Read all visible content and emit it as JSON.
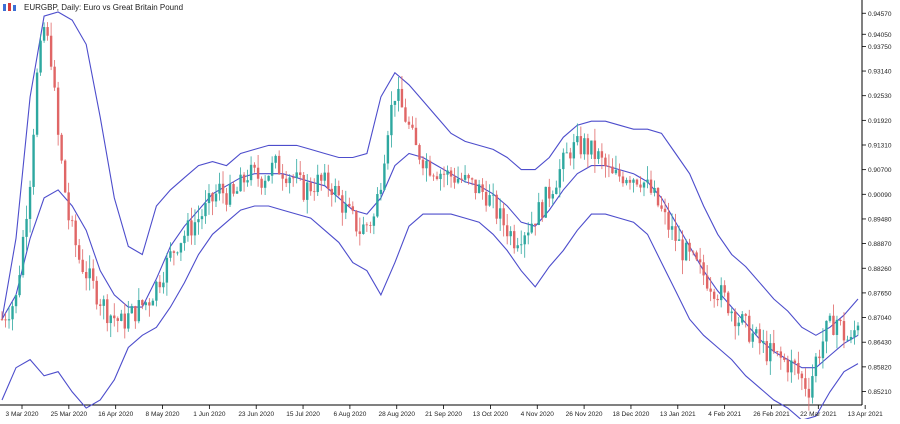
{
  "window": {
    "title": "EURGBP, Daily: Euro vs Great Britain Pound"
  },
  "chart_data": {
    "type": "candlestick",
    "symbol": "EURGBP",
    "timeframe": "Daily",
    "title": "EURGBP, Daily: Euro vs Great Britain Pound",
    "ylim": [
      0.85,
      0.947
    ],
    "y_ticks": [
      "0.94570",
      "0.94050",
      "0.93750",
      "0.93140",
      "0.92530",
      "0.91920",
      "0.91310",
      "0.90700",
      "0.90090",
      "0.89480",
      "0.88870",
      "0.88260",
      "0.87650",
      "0.87040",
      "0.86430",
      "0.85820",
      "0.85210"
    ],
    "y_tick_values": [
      0.9457,
      0.9405,
      0.9375,
      0.9314,
      0.9253,
      0.9192,
      0.9131,
      0.907,
      0.9009,
      0.8948,
      0.8887,
      0.8826,
      0.8765,
      0.8704,
      0.8643,
      0.8582,
      0.8521
    ],
    "x_ticks": [
      "3 Mar 2020",
      "25 Mar 2020",
      "16 Apr 2020",
      "8 May 2020",
      "1 Jun 2020",
      "23 Jun 2020",
      "15 Jul 2020",
      "6 Aug 2020",
      "28 Aug 2020",
      "21 Sep 2020",
      "13 Oct 2020",
      "4 Nov 2020",
      "26 Nov 2020",
      "18 Dec 2020",
      "13 Jan 2021",
      "4 Feb 2021",
      "26 Feb 2021",
      "22 Mar 2021",
      "13 Apr 2021"
    ],
    "close_path": [
      [
        0,
        0.87
      ],
      [
        4,
        0.875
      ],
      [
        8,
        0.905
      ],
      [
        10,
        0.93
      ],
      [
        12,
        0.942
      ],
      [
        14,
        0.935
      ],
      [
        16,
        0.915
      ],
      [
        19,
        0.895
      ],
      [
        22,
        0.885
      ],
      [
        26,
        0.878
      ],
      [
        30,
        0.872
      ],
      [
        34,
        0.869
      ],
      [
        38,
        0.872
      ],
      [
        42,
        0.875
      ],
      [
        46,
        0.882
      ],
      [
        50,
        0.889
      ],
      [
        54,
        0.893
      ],
      [
        58,
        0.897
      ],
      [
        62,
        0.902
      ],
      [
        66,
        0.9
      ],
      [
        70,
        0.906
      ],
      [
        74,
        0.905
      ],
      [
        78,
        0.908
      ],
      [
        82,
        0.906
      ],
      [
        86,
        0.902
      ],
      [
        90,
        0.904
      ],
      [
        94,
        0.903
      ],
      [
        98,
        0.897
      ],
      [
        102,
        0.892
      ],
      [
        106,
        0.895
      ],
      [
        108,
        0.905
      ],
      [
        110,
        0.918
      ],
      [
        112,
        0.926
      ],
      [
        115,
        0.92
      ],
      [
        118,
        0.912
      ],
      [
        122,
        0.908
      ],
      [
        126,
        0.906
      ],
      [
        130,
        0.905
      ],
      [
        134,
        0.903
      ],
      [
        138,
        0.901
      ],
      [
        142,
        0.895
      ],
      [
        146,
        0.89
      ],
      [
        150,
        0.893
      ],
      [
        154,
        0.898
      ],
      [
        158,
        0.905
      ],
      [
        162,
        0.912
      ],
      [
        166,
        0.913
      ],
      [
        170,
        0.91
      ],
      [
        174,
        0.905
      ],
      [
        178,
        0.906
      ],
      [
        182,
        0.905
      ],
      [
        186,
        0.9
      ],
      [
        190,
        0.893
      ],
      [
        194,
        0.887
      ],
      [
        198,
        0.883
      ],
      [
        202,
        0.879
      ],
      [
        206,
        0.875
      ],
      [
        210,
        0.87
      ],
      [
        214,
        0.866
      ],
      [
        218,
        0.862
      ],
      [
        222,
        0.86
      ],
      [
        226,
        0.858
      ],
      [
        228,
        0.855
      ],
      [
        230,
        0.853
      ],
      [
        232,
        0.86
      ],
      [
        235,
        0.867
      ],
      [
        238,
        0.87
      ],
      [
        240,
        0.866
      ],
      [
        242,
        0.864
      ],
      [
        244,
        0.87
      ]
    ],
    "x_extent": [
      0,
      244
    ],
    "series": [
      {
        "name": "upper_band",
        "values": [
          [
            0,
            0.87
          ],
          [
            4,
            0.89
          ],
          [
            8,
            0.925
          ],
          [
            12,
            0.945
          ],
          [
            16,
            0.946
          ],
          [
            20,
            0.944
          ],
          [
            24,
            0.938
          ],
          [
            28,
            0.92
          ],
          [
            32,
            0.9
          ],
          [
            36,
            0.888
          ],
          [
            40,
            0.886
          ],
          [
            44,
            0.898
          ],
          [
            48,
            0.902
          ],
          [
            52,
            0.905
          ],
          [
            56,
            0.908
          ],
          [
            60,
            0.909
          ],
          [
            64,
            0.908
          ],
          [
            68,
            0.911
          ],
          [
            72,
            0.912
          ],
          [
            76,
            0.913
          ],
          [
            80,
            0.913
          ],
          [
            84,
            0.913
          ],
          [
            88,
            0.912
          ],
          [
            92,
            0.911
          ],
          [
            96,
            0.91
          ],
          [
            100,
            0.91
          ],
          [
            104,
            0.911
          ],
          [
            108,
            0.925
          ],
          [
            112,
            0.931
          ],
          [
            116,
            0.928
          ],
          [
            120,
            0.924
          ],
          [
            124,
            0.92
          ],
          [
            128,
            0.916
          ],
          [
            132,
            0.914
          ],
          [
            136,
            0.913
          ],
          [
            140,
            0.912
          ],
          [
            144,
            0.91
          ],
          [
            148,
            0.907
          ],
          [
            152,
            0.907
          ],
          [
            156,
            0.91
          ],
          [
            160,
            0.915
          ],
          [
            164,
            0.918
          ],
          [
            168,
            0.919
          ],
          [
            172,
            0.919
          ],
          [
            176,
            0.918
          ],
          [
            180,
            0.917
          ],
          [
            184,
            0.917
          ],
          [
            188,
            0.916
          ],
          [
            192,
            0.911
          ],
          [
            196,
            0.906
          ],
          [
            200,
            0.898
          ],
          [
            204,
            0.891
          ],
          [
            208,
            0.886
          ],
          [
            212,
            0.883
          ],
          [
            216,
            0.879
          ],
          [
            220,
            0.875
          ],
          [
            224,
            0.872
          ],
          [
            228,
            0.868
          ],
          [
            232,
            0.866
          ],
          [
            236,
            0.868
          ],
          [
            240,
            0.871
          ],
          [
            244,
            0.875
          ]
        ]
      },
      {
        "name": "middle_band",
        "values": [
          [
            0,
            0.87
          ],
          [
            4,
            0.876
          ],
          [
            8,
            0.89
          ],
          [
            12,
            0.9
          ],
          [
            16,
            0.902
          ],
          [
            20,
            0.898
          ],
          [
            24,
            0.892
          ],
          [
            28,
            0.882
          ],
          [
            32,
            0.876
          ],
          [
            36,
            0.873
          ],
          [
            40,
            0.873
          ],
          [
            44,
            0.88
          ],
          [
            48,
            0.888
          ],
          [
            52,
            0.893
          ],
          [
            56,
            0.897
          ],
          [
            60,
            0.901
          ],
          [
            64,
            0.903
          ],
          [
            68,
            0.905
          ],
          [
            72,
            0.906
          ],
          [
            76,
            0.906
          ],
          [
            80,
            0.906
          ],
          [
            84,
            0.905
          ],
          [
            88,
            0.904
          ],
          [
            92,
            0.903
          ],
          [
            96,
            0.9
          ],
          [
            100,
            0.897
          ],
          [
            104,
            0.896
          ],
          [
            108,
            0.9
          ],
          [
            112,
            0.908
          ],
          [
            116,
            0.911
          ],
          [
            120,
            0.91
          ],
          [
            124,
            0.908
          ],
          [
            128,
            0.906
          ],
          [
            132,
            0.904
          ],
          [
            136,
            0.903
          ],
          [
            140,
            0.901
          ],
          [
            144,
            0.898
          ],
          [
            148,
            0.894
          ],
          [
            152,
            0.893
          ],
          [
            156,
            0.897
          ],
          [
            160,
            0.902
          ],
          [
            164,
            0.906
          ],
          [
            168,
            0.908
          ],
          [
            172,
            0.908
          ],
          [
            176,
            0.907
          ],
          [
            180,
            0.906
          ],
          [
            184,
            0.904
          ],
          [
            188,
            0.9
          ],
          [
            192,
            0.894
          ],
          [
            196,
            0.888
          ],
          [
            200,
            0.882
          ],
          [
            204,
            0.877
          ],
          [
            208,
            0.873
          ],
          [
            212,
            0.869
          ],
          [
            216,
            0.865
          ],
          [
            220,
            0.862
          ],
          [
            224,
            0.86
          ],
          [
            228,
            0.858
          ],
          [
            232,
            0.858
          ],
          [
            236,
            0.861
          ],
          [
            240,
            0.864
          ],
          [
            244,
            0.866
          ]
        ]
      },
      {
        "name": "lower_band",
        "values": [
          [
            0,
            0.85
          ],
          [
            4,
            0.858
          ],
          [
            8,
            0.86
          ],
          [
            12,
            0.856
          ],
          [
            16,
            0.857
          ],
          [
            20,
            0.852
          ],
          [
            24,
            0.848
          ],
          [
            28,
            0.85
          ],
          [
            32,
            0.855
          ],
          [
            36,
            0.863
          ],
          [
            40,
            0.866
          ],
          [
            44,
            0.868
          ],
          [
            48,
            0.873
          ],
          [
            52,
            0.879
          ],
          [
            56,
            0.886
          ],
          [
            60,
            0.891
          ],
          [
            64,
            0.894
          ],
          [
            68,
            0.897
          ],
          [
            72,
            0.898
          ],
          [
            76,
            0.898
          ],
          [
            80,
            0.897
          ],
          [
            84,
            0.896
          ],
          [
            88,
            0.895
          ],
          [
            92,
            0.892
          ],
          [
            96,
            0.889
          ],
          [
            100,
            0.884
          ],
          [
            104,
            0.882
          ],
          [
            108,
            0.876
          ],
          [
            112,
            0.884
          ],
          [
            116,
            0.893
          ],
          [
            120,
            0.896
          ],
          [
            124,
            0.896
          ],
          [
            128,
            0.896
          ],
          [
            132,
            0.895
          ],
          [
            136,
            0.894
          ],
          [
            140,
            0.891
          ],
          [
            144,
            0.887
          ],
          [
            148,
            0.882
          ],
          [
            152,
            0.878
          ],
          [
            156,
            0.883
          ],
          [
            160,
            0.887
          ],
          [
            164,
            0.892
          ],
          [
            168,
            0.896
          ],
          [
            172,
            0.896
          ],
          [
            176,
            0.895
          ],
          [
            180,
            0.894
          ],
          [
            184,
            0.891
          ],
          [
            188,
            0.884
          ],
          [
            192,
            0.877
          ],
          [
            196,
            0.87
          ],
          [
            200,
            0.866
          ],
          [
            204,
            0.863
          ],
          [
            208,
            0.86
          ],
          [
            212,
            0.856
          ],
          [
            216,
            0.853
          ],
          [
            220,
            0.85
          ],
          [
            224,
            0.848
          ],
          [
            228,
            0.845
          ],
          [
            232,
            0.846
          ],
          [
            236,
            0.852
          ],
          [
            240,
            0.857
          ],
          [
            244,
            0.859
          ]
        ]
      }
    ],
    "grid": false,
    "candle_colors": {
      "bull": "#2ea8a0",
      "bear": "#e06666"
    },
    "band_color": "#4d4dcc",
    "legend": "none"
  }
}
